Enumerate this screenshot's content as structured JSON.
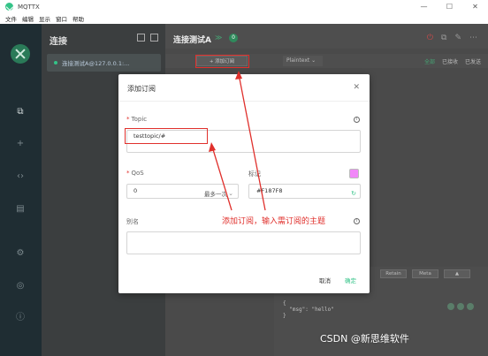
{
  "window": {
    "title": "MQTTX",
    "controls": [
      "—",
      "☐",
      "✕"
    ]
  },
  "menu": [
    "文件",
    "编辑",
    "显示",
    "窗口",
    "帮助"
  ],
  "connections": {
    "header": "连接",
    "items": [
      {
        "label": "连接测试A@127.0.0.1:..."
      }
    ]
  },
  "main": {
    "title": "连接测试A",
    "badge": "0",
    "add_subscription": "+ 添加订阅",
    "payload_format": "Plaintext ⌄",
    "filters": [
      "全部",
      "已接收",
      "已发送"
    ],
    "publish": {
      "retain": "Retain",
      "meta": "Meta",
      "payload": "{\n  \"msg\": \"hello\"\n}"
    }
  },
  "dialog": {
    "title": "添加订阅",
    "topic_label": "Topic",
    "topic_value": "testtopic/#",
    "qos_label": "QoS",
    "qos_value": "0",
    "qos_level": "最多一次",
    "color_label": "标记",
    "color_value": "#F187F8",
    "alias_label": "别名",
    "cancel": "取消",
    "confirm": "确定"
  },
  "annotation": "添加订阅，输入需订阅的主题",
  "watermark": "CSDN @新思维软件",
  "colors": {
    "accent": "#34c388",
    "annotation": "#e0302c",
    "swatch": "#f187f8"
  }
}
